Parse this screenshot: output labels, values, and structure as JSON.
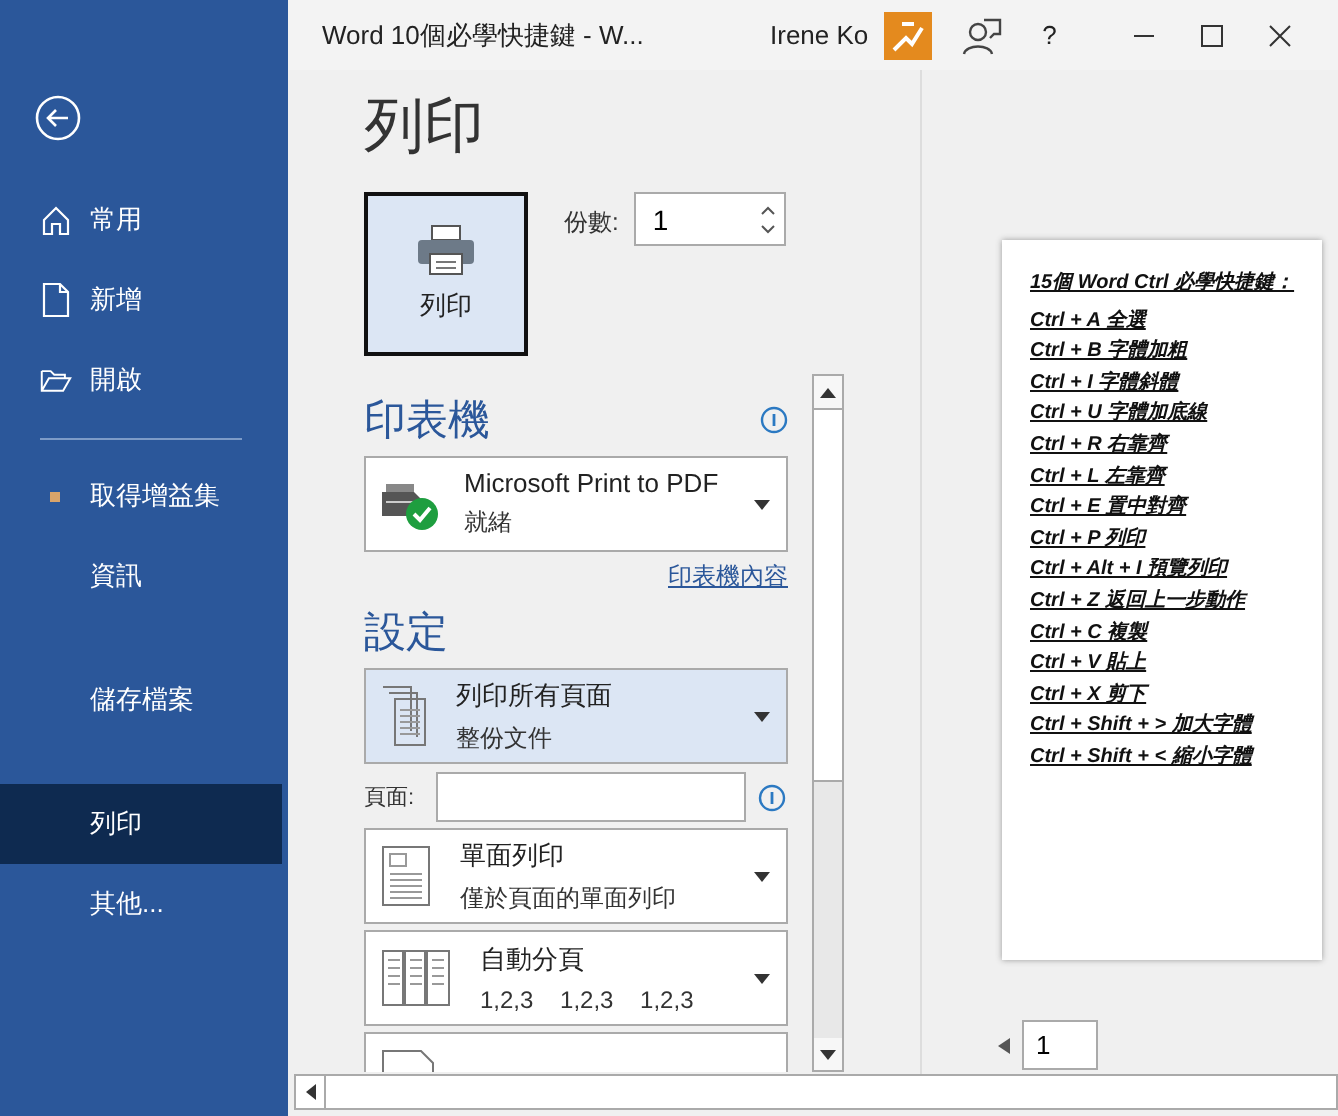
{
  "window": {
    "title": "Word 10個必學快捷鍵  -  W...",
    "user": "Irene Ko",
    "help": "?"
  },
  "sidebar": {
    "items": [
      {
        "kind": "home",
        "label": "常用",
        "selected": false
      },
      {
        "kind": "file",
        "label": "新增",
        "selected": false
      },
      {
        "kind": "folder",
        "label": "開啟",
        "selected": false
      },
      {
        "kind": "divider"
      },
      {
        "kind": "addin",
        "label": "取得增益集",
        "selected": false
      },
      {
        "kind": "plain",
        "label": "資訊",
        "selected": false
      },
      {
        "kind": "plain",
        "label": "儲存檔案",
        "selected": false
      },
      {
        "kind": "plain",
        "label": "列印",
        "selected": true
      },
      {
        "kind": "plain",
        "label": "其他...",
        "selected": false
      }
    ]
  },
  "print": {
    "heading": "列印",
    "button": "列印",
    "copies_label": "份數:",
    "copies": "1"
  },
  "printer": {
    "heading": "印表機",
    "name": "Microsoft Print to PDF",
    "status": "就緒",
    "link": "印表機內容"
  },
  "settings": {
    "heading": "設定",
    "options": [
      {
        "kind": "pages",
        "title": "列印所有頁面",
        "subtitle": "整份文件",
        "selected": true
      },
      {
        "kind": "field",
        "label": "頁面:",
        "selected": false
      },
      {
        "kind": "sides",
        "title": "單面列印",
        "subtitle": "僅於頁面的單面列印",
        "selected": false
      },
      {
        "kind": "collate",
        "title": "自動分頁",
        "subtitle": "1,2,3    1,2,3    1,2,3",
        "selected": false
      },
      {
        "kind": "orientation",
        "selected": false
      }
    ]
  },
  "preview": {
    "lines": [
      "15個 Word Ctrl 必學快捷鍵：",
      "Ctrl + A 全選",
      "Ctrl + B 字體加粗",
      "Ctrl + I 字體斜體",
      "Ctrl + U 字體加底線",
      "Ctrl + R 右靠齊",
      "Ctrl + L 左靠齊",
      "Ctrl + E 置中對齊",
      "Ctrl + P 列印",
      "Ctrl + Alt + I 預覽列印",
      "Ctrl + Z 返回上一步動作",
      "Ctrl + C 複製",
      "Ctrl + V 貼上",
      "Ctrl + X 剪下",
      "Ctrl + Shift + > 加大字體",
      "Ctrl + Shift + < 縮小字體"
    ],
    "page": "1"
  }
}
